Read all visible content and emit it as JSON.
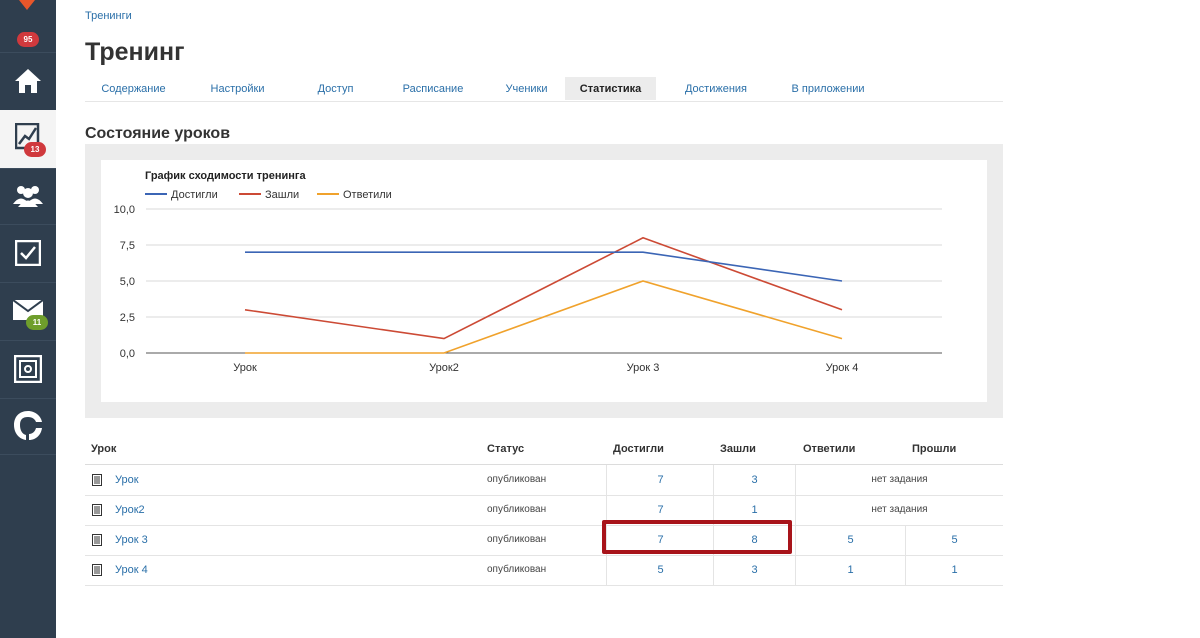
{
  "sidebar": {
    "badges": {
      "top": "95",
      "chart": "13",
      "mail": "11"
    },
    "items": [
      "home-icon",
      "chart-icon",
      "users-icon",
      "tasks-icon",
      "mail-icon",
      "safe-icon",
      "brand-icon"
    ]
  },
  "breadcrumb": "Тренинги",
  "page_title": "Тренинг",
  "tabs": [
    {
      "label": "Содержание"
    },
    {
      "label": "Настройки"
    },
    {
      "label": "Доступ"
    },
    {
      "label": "Расписание"
    },
    {
      "label": "Ученики"
    },
    {
      "label": "Статистика",
      "active": true
    },
    {
      "label": "Достижения"
    },
    {
      "label": "В приложении"
    }
  ],
  "section_title": "Состояние уроков",
  "chart_data": {
    "type": "line",
    "title": "График сходимости тренинга",
    "categories": [
      "Урок",
      "Урок2",
      "Урок 3",
      "Урок 4"
    ],
    "series": [
      {
        "name": "Достигли",
        "values": [
          7,
          7,
          7,
          5
        ],
        "color": "#3b65b5"
      },
      {
        "name": "Зашли",
        "values": [
          3,
          1,
          8,
          3
        ],
        "color": "#cc4a35"
      },
      {
        "name": "Ответили",
        "values": [
          0,
          0,
          5,
          1
        ],
        "color": "#f0a22c"
      }
    ],
    "ylim": [
      0,
      10
    ],
    "yticks": [
      "0,0",
      "2,5",
      "5,0",
      "7,5",
      "10,0"
    ],
    "grid": true,
    "legend": "top-left"
  },
  "table": {
    "headers": {
      "lesson": "Урок",
      "status": "Статус",
      "reached": "Достигли",
      "entered": "Зашли",
      "answered": "Ответили",
      "passed": "Прошли"
    },
    "rows": [
      {
        "lesson": "Урок",
        "status": "опубликован",
        "reached": "7",
        "entered": "3",
        "noans": "нет задания"
      },
      {
        "lesson": "Урок2",
        "status": "опубликован",
        "reached": "7",
        "entered": "1",
        "noans": "нет задания"
      },
      {
        "lesson": "Урок 3",
        "status": "опубликован",
        "reached": "7",
        "entered": "8",
        "answered": "5",
        "passed": "5"
      },
      {
        "lesson": "Урок 4",
        "status": "опубликован",
        "reached": "5",
        "entered": "3",
        "answered": "1",
        "passed": "1"
      }
    ]
  },
  "colors": {
    "sidebar": "#2f3e4e",
    "link": "#2a6fa8",
    "highlight": "#a8141a"
  }
}
